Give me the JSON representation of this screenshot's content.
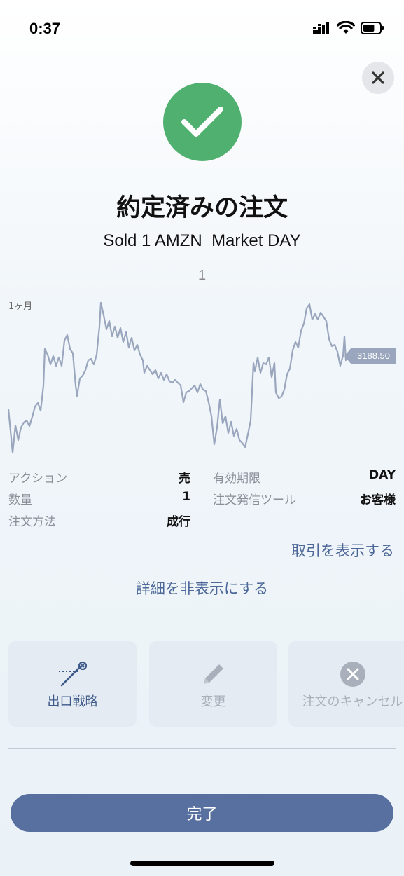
{
  "status_bar": {
    "time": "0:37",
    "battery_level": 0.7
  },
  "header": {
    "title": "約定済みの注文",
    "subtitle": "Sold 1 AMZN  Market DAY",
    "chart_counter": "1"
  },
  "chart": {
    "period_label": "1ヶ月",
    "current_price": "3188.50",
    "line_color": "#9aa6bd"
  },
  "details": {
    "left": [
      {
        "key": "アクション",
        "value": "売"
      },
      {
        "key": "数量",
        "value": "1"
      },
      {
        "key": "注文方法",
        "value": "成行"
      }
    ],
    "right": [
      {
        "key": "有効期限",
        "value": "DAY"
      },
      {
        "key": "注文発信ツール",
        "value": "お客様"
      }
    ]
  },
  "links": {
    "show_trades": "取引を表示する",
    "hide_details": "詳細を非表示にする"
  },
  "actions": [
    {
      "label": "出口戦略",
      "icon": "exit-strategy-icon",
      "enabled": true
    },
    {
      "label": "変更",
      "icon": "pencil-icon",
      "enabled": false
    },
    {
      "label": "注文のキャンセル",
      "icon": "cancel-circle-icon",
      "enabled": false
    }
  ],
  "footer": {
    "done_label": "完了"
  },
  "colors": {
    "success": "#4fb06f",
    "accent": "#5870a0",
    "link": "#4d6898"
  }
}
